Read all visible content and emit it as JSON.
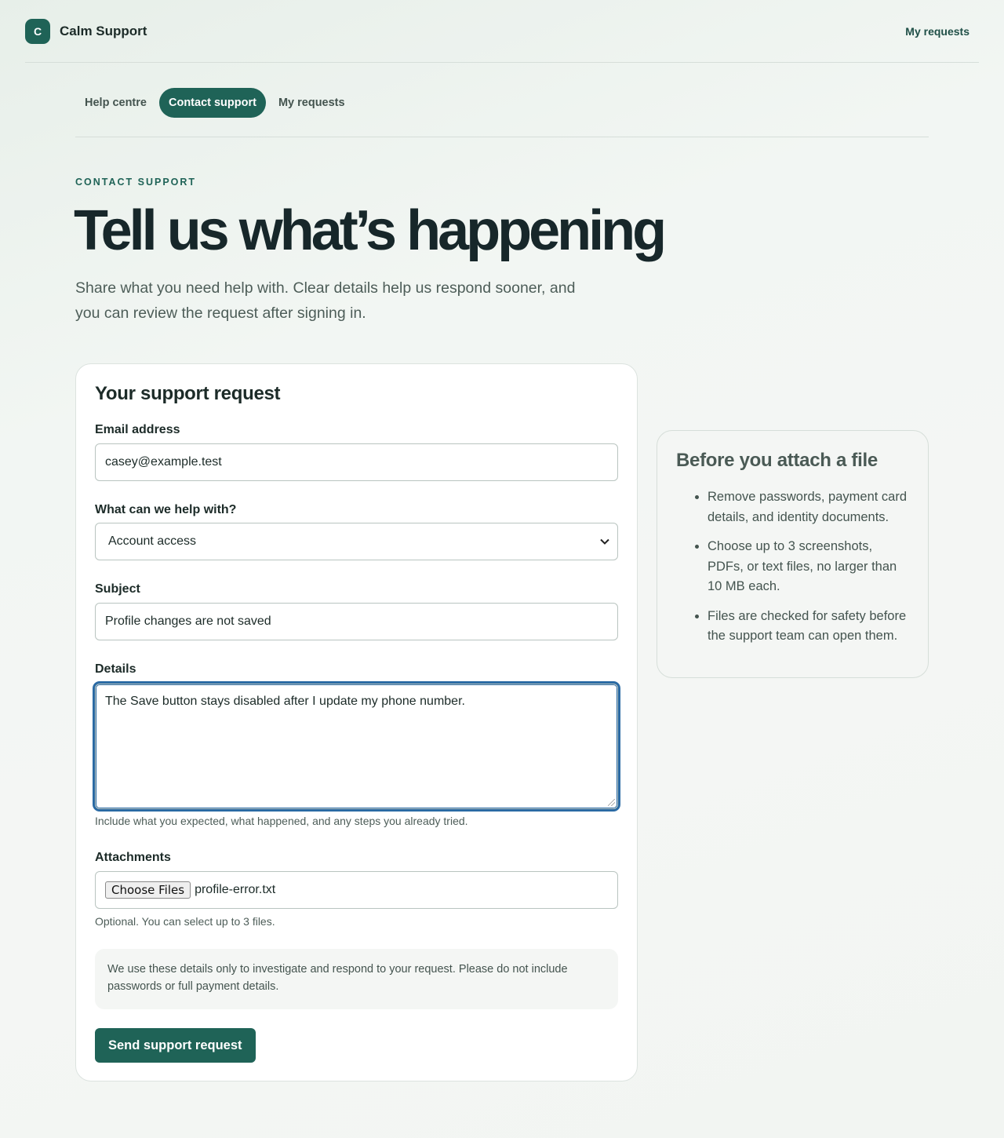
{
  "header": {
    "brand_initial": "C",
    "brand_name": "Calm Support",
    "my_requests_link": "My requests"
  },
  "tabs": [
    {
      "label": "Help centre",
      "active": false
    },
    {
      "label": "Contact support",
      "active": true
    },
    {
      "label": "My requests",
      "active": false
    }
  ],
  "hero": {
    "eyebrow": "CONTACT SUPPORT",
    "title": "Tell us what’s happening",
    "lede": "Share what you need help with. Clear details help us respond sooner, and you can review the request after signing in."
  },
  "form": {
    "title": "Your support request",
    "email": {
      "label": "Email address",
      "value": "casey@example.test"
    },
    "topic": {
      "label": "What can we help with?",
      "selected": "Account access"
    },
    "subject": {
      "label": "Subject",
      "value": "Profile changes are not saved"
    },
    "details": {
      "label": "Details",
      "value": "The Save button stays disabled after I update my phone number.",
      "hint": "Include what you expected, what happened, and any steps you already tried."
    },
    "attachments": {
      "label": "Attachments",
      "button": "Choose Files",
      "file_name": "profile-error.txt",
      "hint": "Optional. You can select up to 3 files."
    },
    "privacy_note": "We use these details only to investigate and respond to your request. Please do not include passwords or full payment details.",
    "submit_label": "Send support request"
  },
  "aside": {
    "title": "Before you attach a file",
    "items": [
      "Remove passwords, payment card details, and identity documents.",
      "Choose up to 3 screenshots, PDFs, or text files, no larger than 10 MB each.",
      "Files are checked for safety before the support team can open them."
    ]
  },
  "colors": {
    "accent": "#1f6357",
    "focus_ring": "#2a6aa4",
    "heading": "#17272a"
  }
}
